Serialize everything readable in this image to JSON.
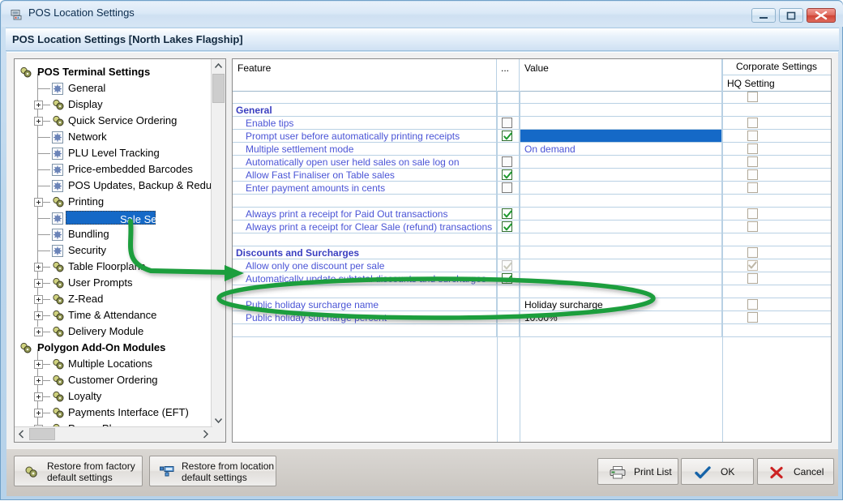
{
  "window": {
    "title": "POS Location Settings",
    "icon": "window-icon",
    "controls": {
      "minimize": "minimize-button",
      "maximize": "maximize-button",
      "close": "close-button"
    }
  },
  "header": {
    "title": "POS Location Settings  [North Lakes Flagship]"
  },
  "tree": {
    "items": [
      {
        "label": "POS Terminal Settings",
        "level": 0,
        "bold": true,
        "icon": "module-icon",
        "expander": "none",
        "selected": false
      },
      {
        "label": "General",
        "level": 1,
        "bold": false,
        "icon": "settings-icon",
        "expander": "none",
        "selected": false
      },
      {
        "label": "Display",
        "level": 1,
        "bold": false,
        "icon": "module-icon",
        "expander": "plus",
        "selected": false
      },
      {
        "label": "Quick Service Ordering",
        "level": 1,
        "bold": false,
        "icon": "module-icon",
        "expander": "plus",
        "selected": false
      },
      {
        "label": "Network",
        "level": 1,
        "bold": false,
        "icon": "settings-icon",
        "expander": "none",
        "selected": false
      },
      {
        "label": "PLU Level Tracking",
        "level": 1,
        "bold": false,
        "icon": "settings-icon",
        "expander": "none",
        "selected": false
      },
      {
        "label": "Price-embedded Barcodes",
        "level": 1,
        "bold": false,
        "icon": "settings-icon",
        "expander": "none",
        "selected": false
      },
      {
        "label": "POS Updates, Backup & Redundancy",
        "level": 1,
        "bold": false,
        "icon": "settings-icon",
        "expander": "none",
        "selected": false
      },
      {
        "label": "Printing",
        "level": 1,
        "bold": false,
        "icon": "module-icon",
        "expander": "plus",
        "selected": false
      },
      {
        "label": "Sale Settlement",
        "level": 1,
        "bold": false,
        "icon": "settings-icon",
        "expander": "none",
        "selected": true
      },
      {
        "label": "Bundling",
        "level": 1,
        "bold": false,
        "icon": "settings-icon",
        "expander": "none",
        "selected": false
      },
      {
        "label": "Security",
        "level": 1,
        "bold": false,
        "icon": "settings-icon",
        "expander": "none",
        "selected": false
      },
      {
        "label": "Table Floorplans",
        "level": 1,
        "bold": false,
        "icon": "module-icon",
        "expander": "plus",
        "selected": false
      },
      {
        "label": "User Prompts",
        "level": 1,
        "bold": false,
        "icon": "module-icon",
        "expander": "plus",
        "selected": false
      },
      {
        "label": "Z-Read",
        "level": 1,
        "bold": false,
        "icon": "module-icon",
        "expander": "plus",
        "selected": false
      },
      {
        "label": "Time & Attendance",
        "level": 1,
        "bold": false,
        "icon": "module-icon",
        "expander": "plus",
        "selected": false
      },
      {
        "label": "Delivery Module",
        "level": 1,
        "bold": false,
        "icon": "module-icon",
        "expander": "plus",
        "selected": false
      },
      {
        "label": "Polygon Add-On Modules",
        "level": 0,
        "bold": true,
        "icon": "module-icon",
        "expander": "none",
        "selected": false
      },
      {
        "label": "Multiple Locations",
        "level": 1,
        "bold": false,
        "icon": "module-icon",
        "expander": "plus",
        "selected": false
      },
      {
        "label": "Customer Ordering",
        "level": 1,
        "bold": false,
        "icon": "module-icon",
        "expander": "plus",
        "selected": false
      },
      {
        "label": "Loyalty",
        "level": 1,
        "bold": false,
        "icon": "module-icon",
        "expander": "plus",
        "selected": false
      },
      {
        "label": "Payments Interface (EFT)",
        "level": 1,
        "bold": false,
        "icon": "module-icon",
        "expander": "plus",
        "selected": false
      },
      {
        "label": "Promo Player",
        "level": 1,
        "bold": false,
        "icon": "module-icon",
        "expander": "plus",
        "selected": false
      }
    ]
  },
  "grid": {
    "group_header": "Corporate Settings",
    "columns": {
      "feature": "Feature",
      "dots": "...",
      "value": "Value",
      "hq": "HQ Setting"
    },
    "rows": [
      {
        "kind": "header-hq",
        "feature": "",
        "check": "none",
        "value": "",
        "value_style": "link",
        "hq": "empty"
      },
      {
        "kind": "section",
        "feature": "General",
        "check": "none",
        "value": "",
        "value_style": "link",
        "hq": "none"
      },
      {
        "kind": "item",
        "feature": "Enable tips",
        "check": "unchecked",
        "value": "",
        "value_style": "link",
        "hq": "empty"
      },
      {
        "kind": "item",
        "feature": "Prompt user before automatically printing receipts",
        "check": "checked",
        "value": "",
        "value_style": "selected",
        "hq": "empty"
      },
      {
        "kind": "item",
        "feature": "Multiple settlement mode",
        "check": "none",
        "value": "On demand",
        "value_style": "link",
        "hq": "empty"
      },
      {
        "kind": "item",
        "feature": "Automatically open user held sales on sale log on",
        "check": "unchecked",
        "value": "",
        "value_style": "link",
        "hq": "empty"
      },
      {
        "kind": "item",
        "feature": "Allow Fast Finaliser on Table sales",
        "check": "checked",
        "value": "",
        "value_style": "link",
        "hq": "empty"
      },
      {
        "kind": "item",
        "feature": "Enter payment amounts in cents",
        "check": "unchecked",
        "value": "",
        "value_style": "link",
        "hq": "empty"
      },
      {
        "kind": "spacer",
        "feature": "",
        "check": "none",
        "value": "",
        "value_style": "link",
        "hq": "none"
      },
      {
        "kind": "item",
        "feature": "Always print a receipt for Paid Out transactions",
        "check": "checked",
        "value": "",
        "value_style": "link",
        "hq": "empty"
      },
      {
        "kind": "item",
        "feature": "Always print a receipt for Clear Sale (refund) transactions",
        "check": "checked",
        "value": "",
        "value_style": "link",
        "hq": "empty"
      },
      {
        "kind": "spacer",
        "feature": "",
        "check": "none",
        "value": "",
        "value_style": "link",
        "hq": "none"
      },
      {
        "kind": "section",
        "feature": "Discounts and Surcharges",
        "check": "none",
        "value": "",
        "value_style": "link",
        "hq": "empty"
      },
      {
        "kind": "item",
        "feature": "Allow only one discount per sale",
        "check": "disabled",
        "value": "",
        "value_style": "link",
        "hq": "checked-disabled"
      },
      {
        "kind": "item",
        "feature": "Automatically update subtotal discounts and surcharges",
        "check": "checked",
        "value": "",
        "value_style": "link",
        "hq": "empty"
      },
      {
        "kind": "spacer",
        "feature": "",
        "check": "none",
        "value": "",
        "value_style": "link",
        "hq": "none"
      },
      {
        "kind": "item",
        "feature": "Public holiday surcharge name",
        "check": "none",
        "value": "Holiday surcharge",
        "value_style": "plain",
        "hq": "empty"
      },
      {
        "kind": "item",
        "feature": "Public holiday surcharge percent",
        "check": "none",
        "value": "10.00%",
        "value_style": "plain",
        "hq": "empty"
      },
      {
        "kind": "spacer",
        "feature": "",
        "check": "none",
        "value": "",
        "value_style": "link",
        "hq": "none"
      }
    ]
  },
  "annotation": {
    "highlight_shape": "ellipse",
    "arrow": "curved-arrow",
    "color": "#1d9e3c"
  },
  "footer": {
    "restore_factory": "Restore from factory\ndefault settings",
    "restore_factory_icon": "factory-defaults-icon",
    "restore_location": "Restore from location\ndefault settings",
    "restore_location_icon": "location-defaults-icon",
    "print_list": "Print List",
    "print_icon": "printer-icon",
    "ok": "OK",
    "ok_icon": "check-icon",
    "cancel": "Cancel",
    "cancel_icon": "cross-icon"
  }
}
